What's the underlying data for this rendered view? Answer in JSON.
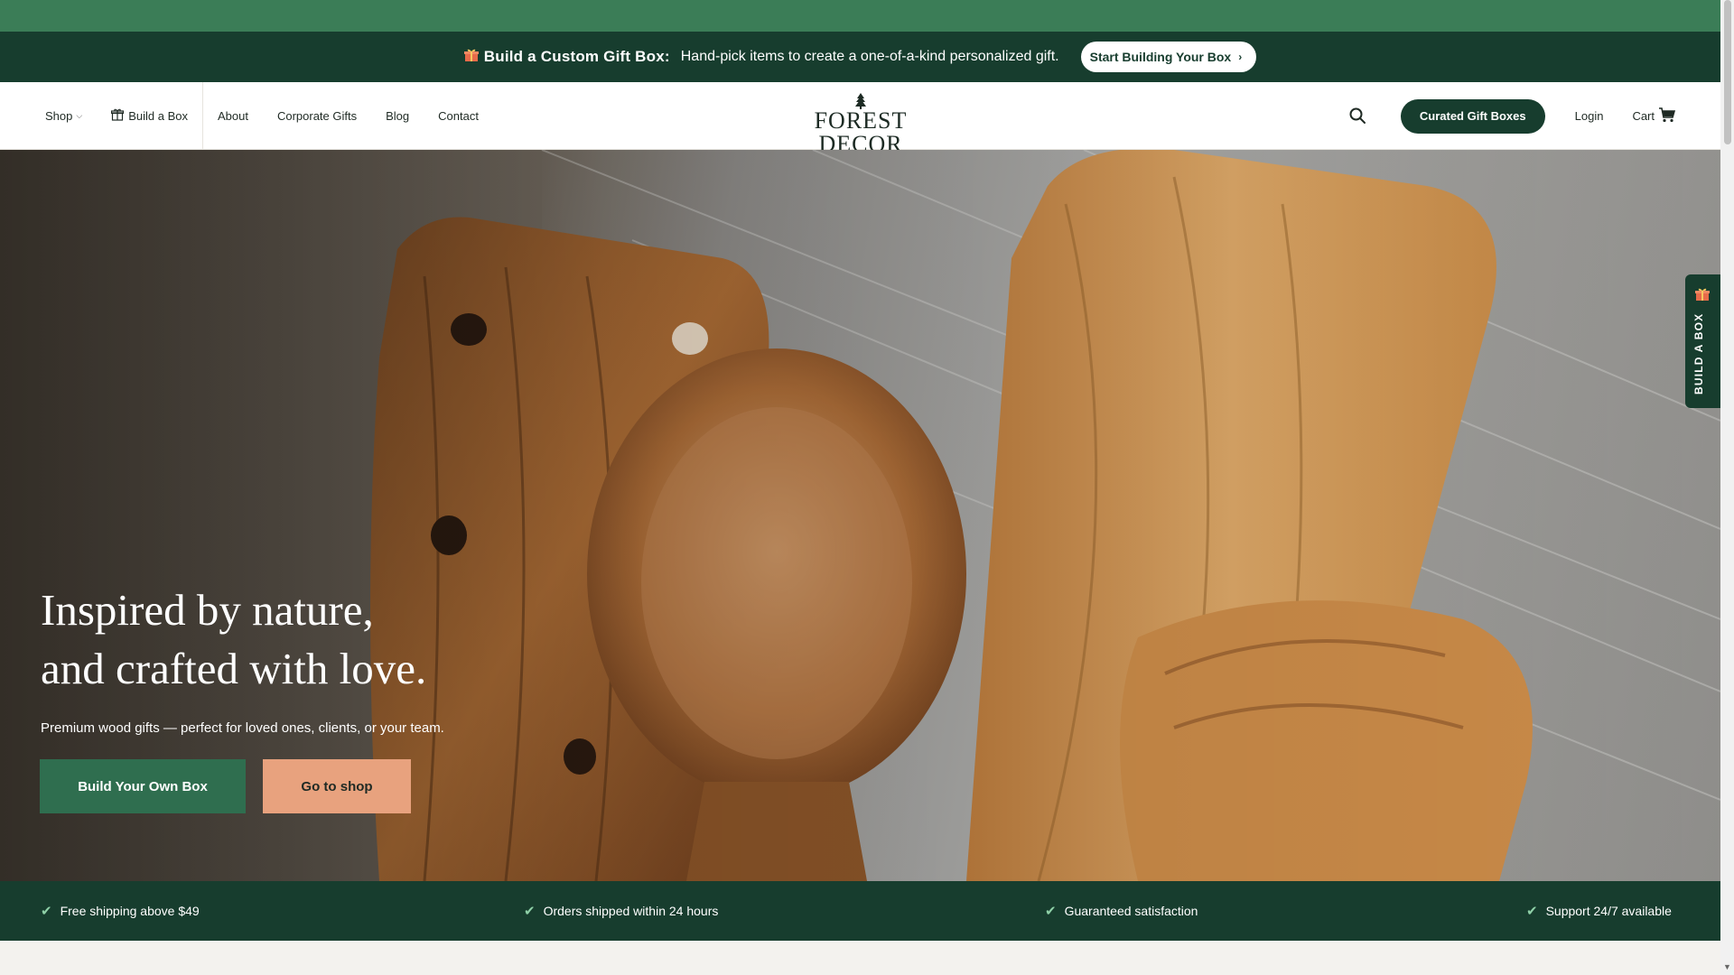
{
  "announcement": {
    "icon": "gift-icon",
    "headline": "Build a Custom Gift Box:",
    "message": "Hand-pick items to create a one-of-a-kind personalized gift.",
    "cta_label": "Start Building Your Box"
  },
  "nav": {
    "shop_label": "Shop",
    "build_box_label": "Build a Box",
    "about_label": "About",
    "corporate_label": "Corporate Gifts",
    "blog_label": "Blog",
    "contact_label": "Contact"
  },
  "logo": {
    "text": "FOREST DECOR"
  },
  "header_right": {
    "search_icon": "search-icon",
    "curated_label": "Curated Gift Boxes",
    "login_label": "Login",
    "cart_label": "Cart",
    "cart_icon": "cart-icon"
  },
  "hero": {
    "title_line1": "Inspired by nature,",
    "title_line2": "and crafted with love.",
    "subtitle": "Premium wood gifts — perfect for loved ones, clients, or your team.",
    "primary_cta": "Build Your Own Box",
    "secondary_cta": "Go to shop"
  },
  "side_tab": {
    "label": "BUILD A BOX",
    "icon": "gift-icon"
  },
  "benefits": [
    {
      "label": "Free shipping above $49"
    },
    {
      "label": "Orders shipped within 24 hours"
    },
    {
      "label": "Guaranteed satisfaction"
    },
    {
      "label": "Support 24/7 available"
    }
  ],
  "colors": {
    "dark_green": "#173d2e",
    "green": "#2f6e4f",
    "top_strip": "#3b7d57",
    "peach": "#e8a27e"
  }
}
